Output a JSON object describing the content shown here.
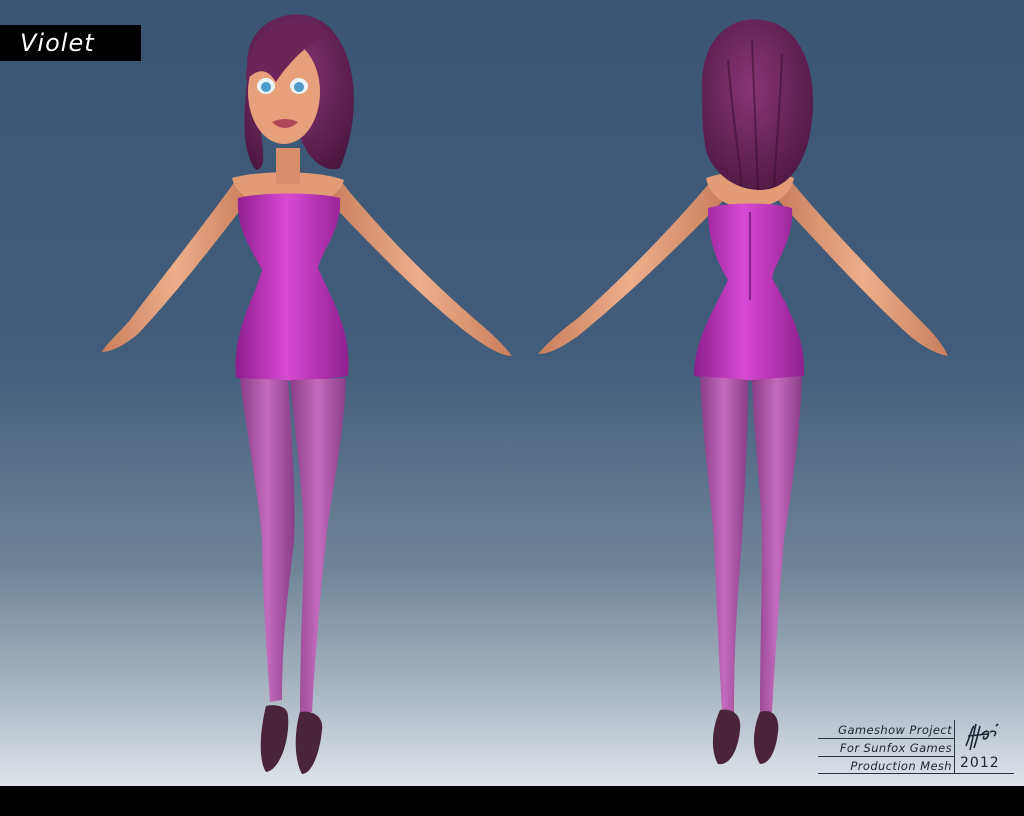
{
  "title": "Violet",
  "credits": {
    "line1": "Gameshow Project",
    "line2": "For Sunfox Games",
    "line3": "Production Mesh",
    "year": "2012"
  },
  "colors": {
    "dress": "#c22fbf",
    "tights": "#b94fb2",
    "skin": "#e8a07a",
    "hair": "#5e1f4f",
    "shoes": "#4a2438",
    "background_top": "#3b5674",
    "background_bottom": "#dfe4ea"
  },
  "figures": [
    {
      "view": "front",
      "icon": "character-front-view"
    },
    {
      "view": "back",
      "icon": "character-back-view"
    }
  ]
}
